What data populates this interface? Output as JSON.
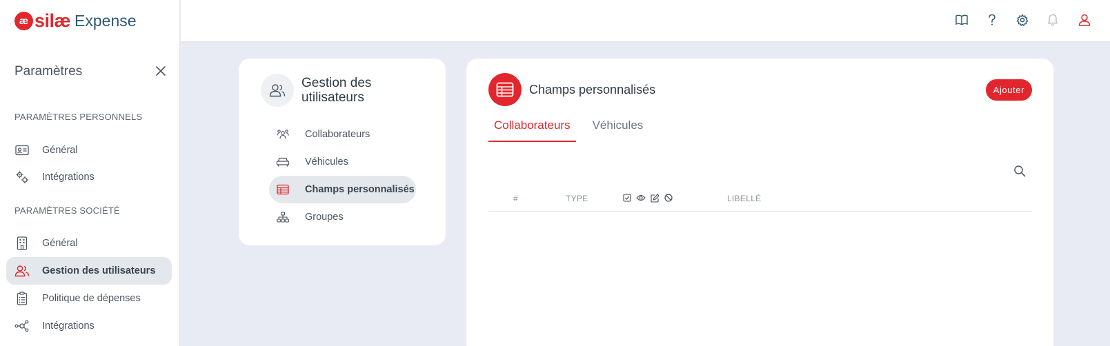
{
  "app": {
    "logo_mark": "æ",
    "logo_brand": "silæ",
    "logo_product": "Expense"
  },
  "sidebar": {
    "title": "Paramètres",
    "sections": [
      {
        "label": "PARAMÈTRES PERSONNELS",
        "items": [
          {
            "label": "Général",
            "icon": "id-card-icon"
          },
          {
            "label": "Intégrations",
            "icon": "gears-icon"
          }
        ]
      },
      {
        "label": "PARAMÈTRES SOCIÉTÉ",
        "items": [
          {
            "label": "Général",
            "icon": "building-icon"
          },
          {
            "label": "Gestion des utilisateurs",
            "icon": "users-icon",
            "active": true
          },
          {
            "label": "Politique de dépenses",
            "icon": "clipboard-list-icon"
          },
          {
            "label": "Intégrations",
            "icon": "network-icon"
          }
        ]
      }
    ]
  },
  "topbar": {
    "icons": [
      "book-icon",
      "help-icon",
      "settings-icon",
      "bell-icon",
      "user-icon"
    ]
  },
  "submenu": {
    "title": "Gestion des utilisateurs",
    "items": [
      {
        "label": "Collaborateurs",
        "icon": "team-icon"
      },
      {
        "label": "Véhicules",
        "icon": "car-icon"
      },
      {
        "label": "Champs personnalisés",
        "icon": "table-icon",
        "active": true
      },
      {
        "label": "Groupes",
        "icon": "hierarchy-icon"
      }
    ]
  },
  "content": {
    "title": "Champs personnalisés",
    "add_label": "Ajouter",
    "tabs": [
      {
        "label": "Collaborateurs",
        "active": true
      },
      {
        "label": "Véhicules"
      }
    ],
    "columns": {
      "number": "#",
      "type": "TYPE",
      "icons": [
        "checkbox-icon",
        "eye-icon",
        "edit-icon",
        "ban-icon"
      ],
      "label": "LIBELLÉ"
    },
    "rows": []
  },
  "colors": {
    "accent": "#e1272d",
    "brand_dark": "#2d5873",
    "background": "#e9ebf4"
  }
}
